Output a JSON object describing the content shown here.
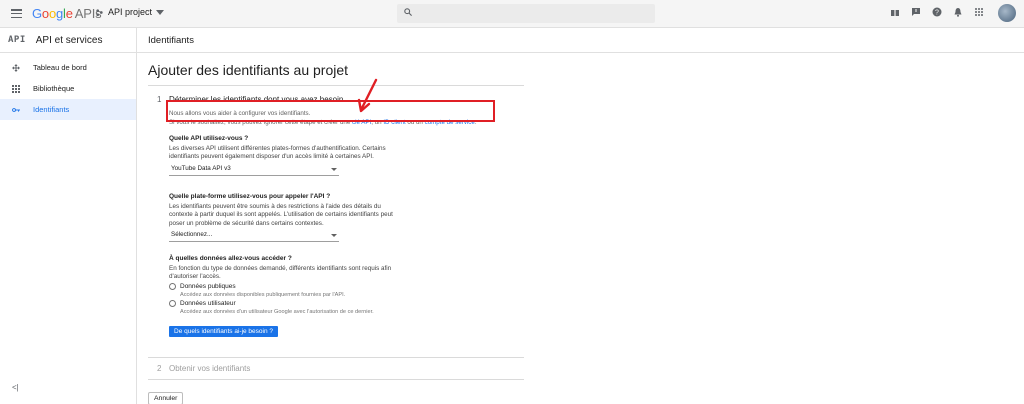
{
  "topbar": {
    "logo_letters": [
      "G",
      "o",
      "o",
      "g",
      "l",
      "e"
    ],
    "logo_suffix": "APIs",
    "project_label": "API project",
    "icons": [
      "gift-icon",
      "feedback-icon",
      "help-icon",
      "notifications-icon",
      "apps-icon"
    ],
    "brand_colors": {
      "blue": "#4285f4",
      "red": "#ea4335",
      "yellow": "#fbbc05",
      "green": "#34a853"
    }
  },
  "sidebar": {
    "badge": "API",
    "title": "API et services",
    "items": [
      {
        "label": "Tableau de bord",
        "icon": "dashboard-icon",
        "active": false
      },
      {
        "label": "Bibliothèque",
        "icon": "library-icon",
        "active": false
      },
      {
        "label": "Identifiants",
        "icon": "key-icon",
        "active": true
      }
    ],
    "collapse_label": "<|"
  },
  "page_header": "Identifiants",
  "main": {
    "title": "Ajouter des identifiants au projet",
    "step1": {
      "number": "1",
      "title": "Déterminer les identifiants dont vous avez besoin"
    },
    "intro_line1": "Nous allons vous aider à configurer vos identifiants.",
    "intro_line2_prefix": "Si vous le souhaitez, vous pouvez ignorer cette étape et créer une ",
    "intro_link_key": "clé API",
    "intro_sep1": ", un ",
    "intro_link_client": "ID client",
    "intro_sep2": " ou un ",
    "intro_link_sa": "compte de service",
    "intro_end": ".",
    "q_api": "Quelle API utilisez-vous ?",
    "q_api_desc": "Les diverses API utilisent différentes plates-formes d'authentification. Certains identifiants peuvent également disposer d'un accès limité à certaines API.",
    "api_select_value": "YouTube Data API v3",
    "q_platform": "Quelle plate-forme utilisez-vous pour appeler l'API ?",
    "q_platform_desc": "Les identifiants peuvent être soumis à des restrictions à l'aide des détails du contexte à partir duquel ils sont appelés. L'utilisation de certains identifiants peut poser un problème de sécurité dans certains contextes.",
    "platform_select_value": "Sélectionnez...",
    "q_data": "À quelles données allez-vous accéder ?",
    "q_data_desc": "En fonction du type de données demandé, différents identifiants sont requis afin d'autoriser l'accès.",
    "radio_public_label": "Données publiques",
    "radio_public_desc": "Accédez aux données disponibles publiquement fournies par l'API.",
    "radio_user_label": "Données utilisateur",
    "radio_user_desc": "Accédez aux données d'un utilisateur Google avec l'autorisation de ce dernier.",
    "which_btn": "De quels identifiants ai-je besoin ?",
    "step2": {
      "number": "2",
      "title": "Obtenir vos identifiants"
    },
    "cancel_btn": "Annuler"
  },
  "annotation_color": "#e01f25"
}
